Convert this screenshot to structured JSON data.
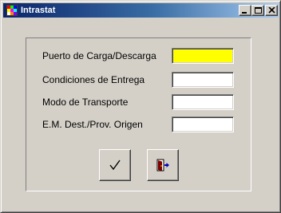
{
  "window": {
    "title": "Intrastat",
    "icons": {
      "app": "app-icon",
      "minimize": "minimize-icon",
      "maximize": "maximize-icon",
      "close": "close-icon"
    }
  },
  "form": {
    "fields": [
      {
        "label": "Puerto de Carga/Descarga",
        "value": "",
        "highlight_color": "#ffff00"
      },
      {
        "label": "Condiciones de Entrega",
        "value": ""
      },
      {
        "label": "Modo de Transporte",
        "value": ""
      },
      {
        "label": "E.M. Dest./Prov. Origen",
        "value": ""
      }
    ]
  },
  "actions": {
    "ok_icon": "checkmark-icon",
    "exit_icon": "exit-door-icon"
  }
}
